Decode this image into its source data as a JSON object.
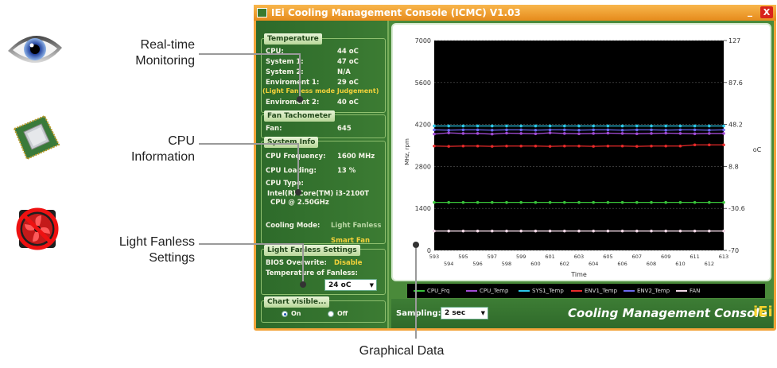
{
  "callouts": {
    "realtime_1": "Real-time",
    "realtime_2": "Monitoring",
    "cpu_1": "CPU",
    "cpu_2": "Information",
    "fanless_1": "Light Fanless",
    "fanless_2": "Settings",
    "graph": "Graphical Data"
  },
  "window": {
    "title": "IEi Cooling Management Console (ICMC) V1.03",
    "minimize": "_",
    "close": "X"
  },
  "temperature": {
    "header": "Temperature",
    "rows": [
      {
        "label": "CPU:",
        "value": "44 oC"
      },
      {
        "label": "System 1:",
        "value": "47 oC"
      },
      {
        "label": "System 2:",
        "value": "N/A"
      },
      {
        "label": "Enviroment 1:",
        "value": "29 oC"
      },
      {
        "label": "(Light Fanless mode Judgement)",
        "value": ""
      },
      {
        "label": "Enviroment 2:",
        "value": "40 oC"
      }
    ]
  },
  "fan": {
    "header": "Fan Tachometer",
    "label": "Fan:",
    "value": "645"
  },
  "sysinfo": {
    "header": "System Info",
    "freq_label": "CPU Frequency:",
    "freq_value": "1600 MHz",
    "load_label": "CPU Loading:",
    "load_value": "13 %",
    "type_label": "CPU Type:",
    "type_value_1": "Intel(R) Core(TM) i3-2100T",
    "type_value_2": "CPU @ 2.50GHz",
    "mode_label": "Cooling Mode:",
    "mode_value": "Light Fanless",
    "mode_value_2": "Smart Fan"
  },
  "fanless": {
    "header": "Light Fanless Settings",
    "bios_label": "BIOS Overwrite:",
    "bios_value": "Disable",
    "temp_label": "Temperature of Fanless:",
    "temp_value": "24 oC"
  },
  "chartvis": {
    "header": "Chart visible...",
    "on": "On",
    "off": "Off"
  },
  "bottom": {
    "sampling_label": "Sampling:",
    "sampling_value": "2 sec",
    "brand": "Cooling Management Console",
    "logo": "iEi"
  },
  "chart_data": {
    "type": "line",
    "xlabel": "Time",
    "ylabel": "MHz, rpm",
    "ylabel_right": "oC",
    "ylim": [
      0,
      7000
    ],
    "y_ticks": [
      0,
      1400,
      2800,
      4200,
      5600,
      7000
    ],
    "y2lim": [
      -70,
      127
    ],
    "y2_ticks": [
      -70,
      -30.6,
      8.8,
      48.2,
      87.6,
      127
    ],
    "x_ticks_top": [
      593,
      595,
      597,
      599,
      601,
      603,
      605,
      607,
      609,
      611,
      613
    ],
    "x_ticks_bottom": [
      594,
      596,
      598,
      600,
      602,
      604,
      606,
      608,
      610,
      612
    ],
    "x": [
      593,
      594,
      595,
      596,
      597,
      598,
      599,
      600,
      601,
      602,
      603,
      604,
      605,
      606,
      607,
      608,
      609,
      610,
      611,
      612,
      613
    ],
    "series": [
      {
        "name": "CPU_Frq",
        "color": "#39c43a",
        "values": [
          1600,
          1600,
          1600,
          1600,
          1600,
          1600,
          1600,
          1600,
          1600,
          1600,
          1600,
          1600,
          1600,
          1600,
          1600,
          1600,
          1600,
          1600,
          1600,
          1600,
          1600
        ]
      },
      {
        "name": "CPU_Temp",
        "color": "#a24bd6",
        "values": [
          3880,
          3920,
          3900,
          3900,
          3880,
          3910,
          3900,
          3890,
          3920,
          3900,
          3890,
          3900,
          3910,
          3900,
          3890,
          3900,
          3910,
          3900,
          3890,
          3900,
          3900
        ]
      },
      {
        "name": "SYS1_Temp",
        "color": "#2bc8e8",
        "values": [
          4150,
          4150,
          4150,
          4150,
          4150,
          4150,
          4150,
          4150,
          4150,
          4150,
          4150,
          4150,
          4150,
          4150,
          4150,
          4150,
          4150,
          4150,
          4150,
          4150,
          4150
        ]
      },
      {
        "name": "ENV1_Temp",
        "color": "#e82a2a",
        "values": [
          3480,
          3470,
          3480,
          3480,
          3470,
          3480,
          3480,
          3480,
          3470,
          3480,
          3480,
          3470,
          3480,
          3480,
          3470,
          3480,
          3480,
          3480,
          3520,
          3520,
          3520
        ]
      },
      {
        "name": "ENV2_Temp",
        "color": "#6b6bf0",
        "values": [
          4020,
          4010,
          4020,
          4020,
          4010,
          4020,
          4020,
          4010,
          4020,
          4020,
          4010,
          4020,
          4020,
          4010,
          4020,
          4020,
          4010,
          4020,
          4020,
          4010,
          4020
        ]
      },
      {
        "name": "FAN",
        "color": "#f2d8e6",
        "values": [
          645,
          645,
          645,
          645,
          645,
          645,
          645,
          645,
          645,
          645,
          645,
          645,
          645,
          645,
          645,
          645,
          645,
          645,
          645,
          645,
          645
        ]
      }
    ]
  }
}
